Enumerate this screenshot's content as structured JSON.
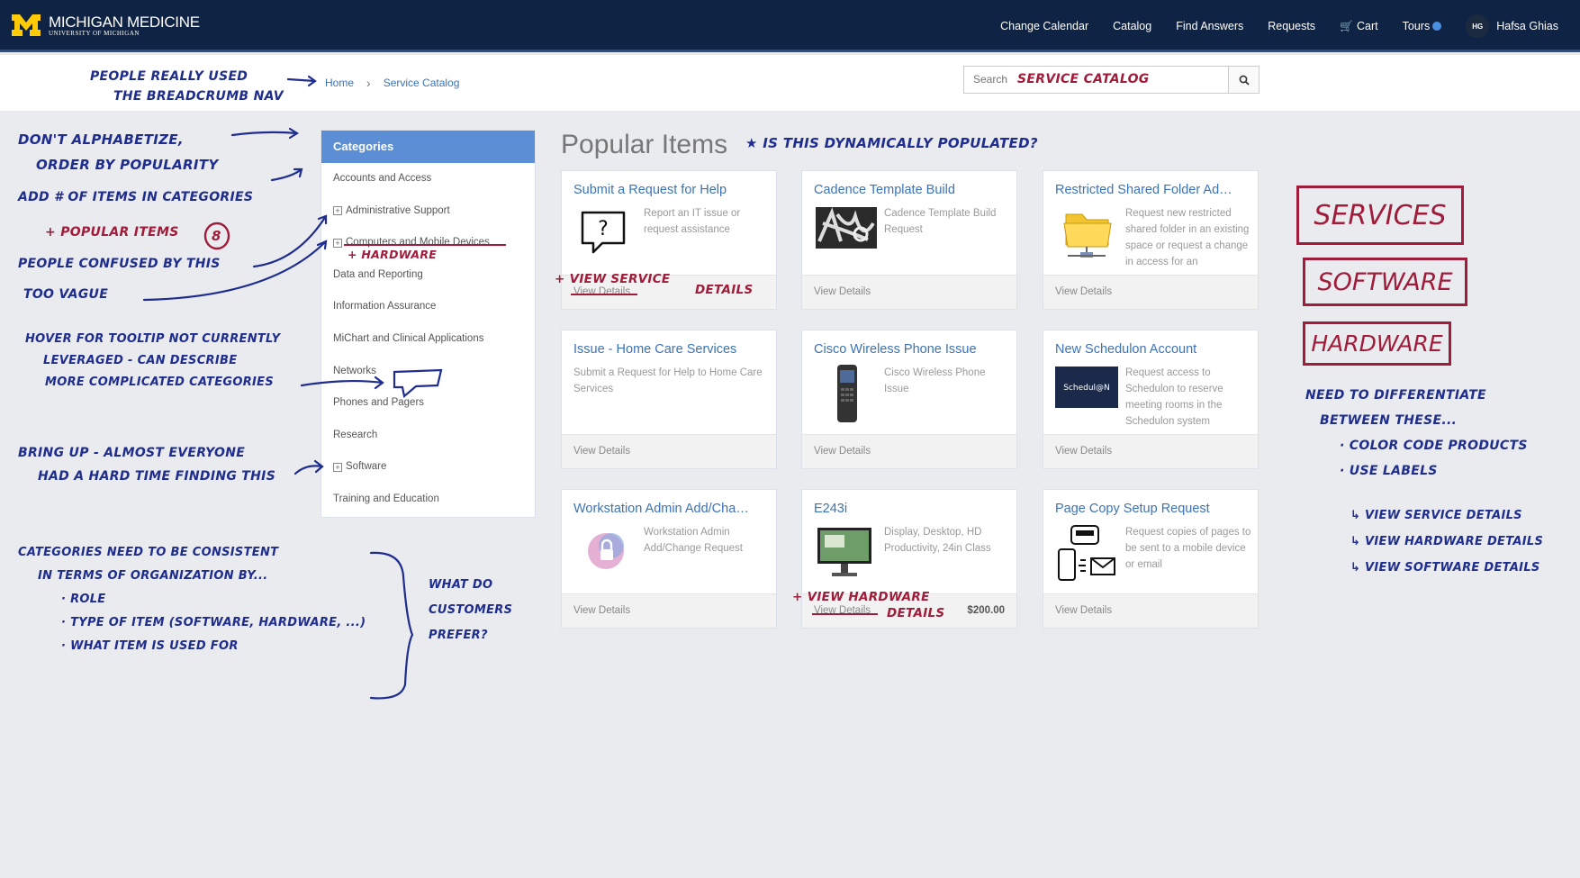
{
  "brand": {
    "title": "MICHIGAN MEDICINE",
    "subtitle": "UNIVERSITY OF MICHIGAN"
  },
  "nav": {
    "items": [
      "Change Calendar",
      "Catalog",
      "Find Answers",
      "Requests",
      "Cart",
      "Tours"
    ],
    "avatar_initials": "HG",
    "user_name": "Hafsa Ghias"
  },
  "breadcrumb": {
    "home": "Home",
    "current": "Service Catalog"
  },
  "search": {
    "placeholder": "Search",
    "annotation": "SERVICE CATALOG"
  },
  "categories": {
    "heading": "Categories",
    "items": [
      {
        "label": "Accounts and Access",
        "expandable": false
      },
      {
        "label": "Administrative Support",
        "expandable": true
      },
      {
        "label": "Computers and Mobile Devices",
        "expandable": true
      },
      {
        "label": "Data and Reporting",
        "expandable": false
      },
      {
        "label": "Information Assurance",
        "expandable": false
      },
      {
        "label": "MiChart and Clinical Applications",
        "expandable": false
      },
      {
        "label": "Networks",
        "expandable": false
      },
      {
        "label": "Phones and Pagers",
        "expandable": false
      },
      {
        "label": "Research",
        "expandable": false
      },
      {
        "label": "Software",
        "expandable": true
      },
      {
        "label": "Training and Education",
        "expandable": false
      }
    ]
  },
  "popular": {
    "title": "Popular Items",
    "cards": [
      {
        "title": "Submit a Request for Help",
        "desc": "Report an IT issue or request assistance",
        "link": "View Details",
        "price": "",
        "icon": "help-bubble-icon"
      },
      {
        "title": "Cadence Template Build",
        "desc": "Cadence Template Build Request",
        "link": "View Details",
        "price": "",
        "icon": "cadence-image"
      },
      {
        "title": "Restricted Shared Folder Ad…",
        "desc": "Request new restricted shared folder in an existing space or request a change in access for an",
        "link": "View Details",
        "price": "",
        "icon": "folder-network-icon"
      },
      {
        "title": "Issue - Home Care Services",
        "desc": "Submit a Request for Help to Home Care Services",
        "link": "View Details",
        "price": "",
        "icon": ""
      },
      {
        "title": "Cisco Wireless Phone Issue",
        "desc": "Cisco Wireless Phone Issue",
        "link": "View Details",
        "price": "",
        "icon": "wireless-phone-image"
      },
      {
        "title": "New Schedulon Account",
        "desc": "Request access to Schedulon to reserve meeting rooms in the Schedulon system",
        "link": "View Details",
        "price": "",
        "icon": "schedulon-logo"
      },
      {
        "title": "Workstation Admin Add/Cha…",
        "desc": "Workstation Admin Add/Change Request",
        "link": "View Details",
        "price": "",
        "icon": "lock-icon"
      },
      {
        "title": "E243i",
        "desc": "Display, Desktop, HD Productivity, 24in Class",
        "link": "View Details",
        "price": "$200.00",
        "icon": "monitor-image"
      },
      {
        "title": "Page Copy Setup Request",
        "desc": "Request copies of pages to be sent to a mobile device or email",
        "link": "View Details",
        "price": "",
        "icon": "pager-icon"
      }
    ]
  },
  "annotations": {
    "breadcrumb_note": [
      "PEOPLE REALLY USED",
      "THE BREADCRUMB NAV"
    ],
    "alphabetize_note": [
      "DON'T ALPHABETIZE,",
      "ORDER BY POPULARITY"
    ],
    "count_note": "ADD # OF ITEMS IN CATEGORIES",
    "popular_items_note": "+ POPULAR ITEMS",
    "popular_items_count": "8",
    "confused_note": "PEOPLE CONFUSED BY THIS",
    "hardware_note": "+ HARDWARE",
    "vague_note": "TOO VAGUE",
    "tooltip_note": [
      "HOVER FOR TOOLTIP NOT CURRENTLY",
      "LEVERAGED - CAN DESCRIBE",
      "MORE COMPLICATED CATEGORIES"
    ],
    "bring_up_note": [
      "BRING UP - ALMOST EVERYONE",
      "HAD A HARD TIME FINDING THIS"
    ],
    "consistency_note": [
      "CATEGORIES NEED TO BE CONSISTENT",
      "IN TERMS OF ORGANIZATION BY..."
    ],
    "consistency_items": [
      "· ROLE",
      "· TYPE OF ITEM (SOFTWARE, HARDWARE, ...)",
      "· WHAT ITEM IS USED FOR"
    ],
    "customers_note": [
      "WHAT DO",
      "CUSTOMERS",
      "PREFER?"
    ],
    "dynamic_note": "IS THIS DYNAMICALLY POPULATED?",
    "service_details_note": [
      "+ VIEW SERVICE",
      "DETAILS"
    ],
    "hardware_details_note": [
      "+ VIEW HARDWARE",
      "DETAILS"
    ],
    "labels_boxes": [
      "SERVICES",
      "SOFTWARE",
      "HARDWARE"
    ],
    "differentiate_note": [
      "NEED TO DIFFERENTIATE",
      "BETWEEN THESE..."
    ],
    "differentiate_items": [
      "· COLOR CODE PRODUCTS",
      "· USE LABELS"
    ],
    "label_examples": [
      "VIEW SERVICE DETAILS",
      "VIEW HARDWARE DETAILS",
      "VIEW SOFTWARE DETAILS"
    ]
  }
}
